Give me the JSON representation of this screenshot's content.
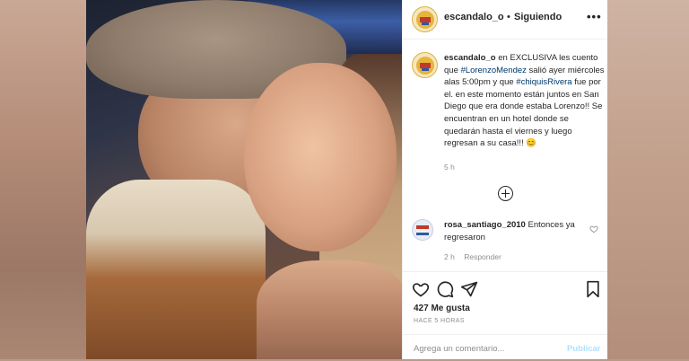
{
  "post": {
    "author": "escandalo_o",
    "separator": "•",
    "follow_status": "Siguiendo",
    "more_icon": "more-horizontal-icon"
  },
  "caption": {
    "author": "escandalo_o",
    "part1": " en EXCLUSIVA les cuento que ",
    "tag1": "#LorenzoMendez",
    "part2": " salió ayer miércoles alas 5:00pm y que ",
    "tag2": "#chiquisRivera",
    "part3": " fue por el. en este momento están juntos en San Diego que era donde estaba Lorenzo!! Se encuentran en un hotel donde se quedarán hasta el viernes y luego regresan a su casa!!! 😊",
    "time": "5 h"
  },
  "comment": {
    "author": "rosa_santiago_2010",
    "text": " Entonces ya regresaron",
    "time": "2 h",
    "reply_label": "Responder"
  },
  "footer": {
    "likes": "427 Me gusta",
    "posted": "HACE 5 HORAS",
    "comment_placeholder": "Agrega un comentario...",
    "publish_label": "Publicar"
  },
  "colors": {
    "tag": "#00376b",
    "muted": "#8e8e8e",
    "publish": "#b2dffc"
  }
}
